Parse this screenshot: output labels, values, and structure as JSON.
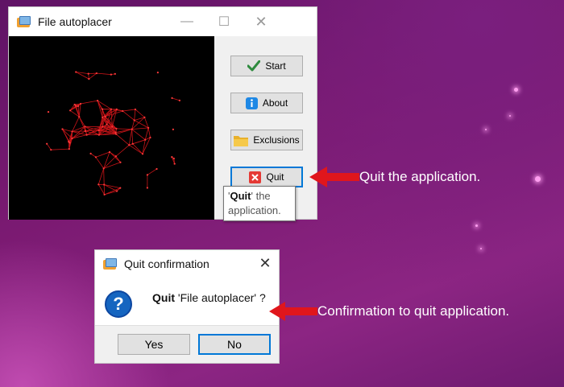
{
  "main_window": {
    "title": "File autoplacer",
    "controls": {
      "minimize": "—",
      "maximize": "☐",
      "close": "✕"
    },
    "buttons": {
      "start": "Start",
      "about": "About",
      "exclusions": "Exclusions",
      "quit": "Quit"
    },
    "tooltip": {
      "bold": "Quit",
      "rest_line1": "' the",
      "rest_line2": "application."
    }
  },
  "dialog": {
    "title": "Quit confirmation",
    "close": "✕",
    "icon_glyph": "?",
    "message_bold": "Quit",
    "message_rest": " 'File autoplacer' ?",
    "yes": "Yes",
    "no": "No"
  },
  "annotations": {
    "quit_note": "Quit the application.",
    "confirm_note": "Confirmation to quit application."
  },
  "colors": {
    "arrow": "#e0161c",
    "accent": "#0078d7",
    "background": "#7b1a72"
  }
}
